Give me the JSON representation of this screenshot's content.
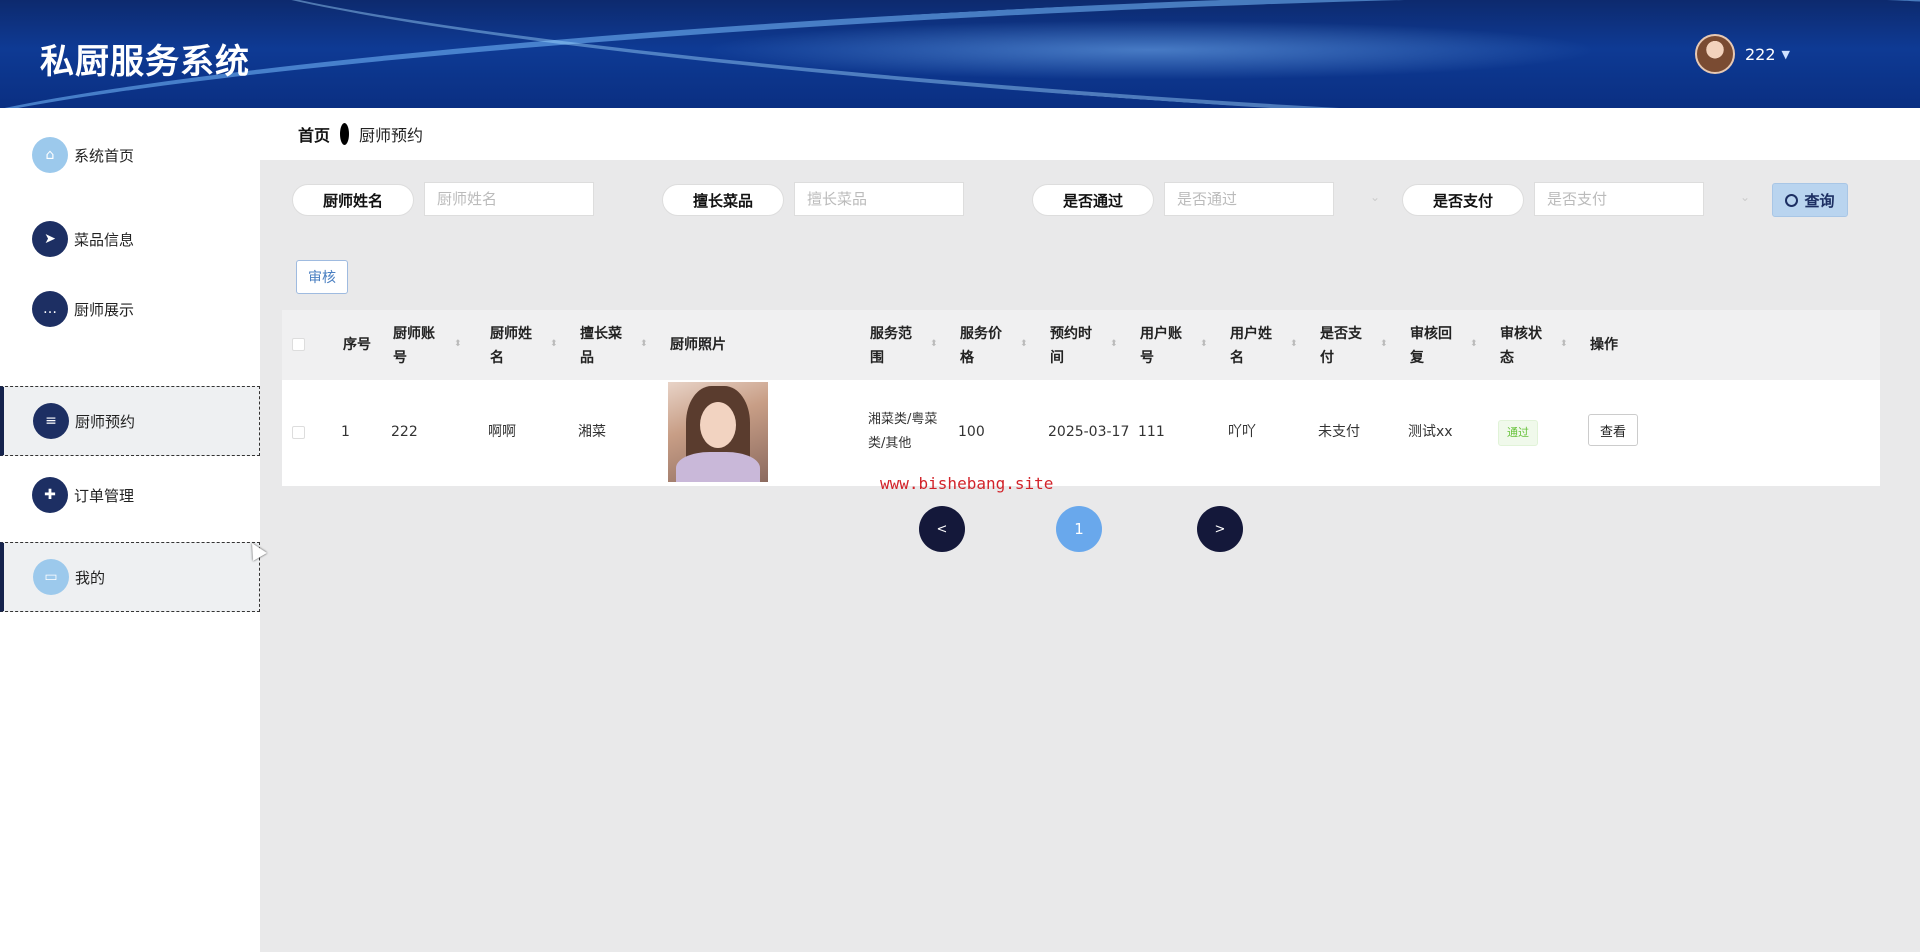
{
  "header": {
    "title": "私厨服务系统",
    "username": "222"
  },
  "sidebar": {
    "items": [
      {
        "label": "系统首页",
        "icon": "home-icon"
      },
      {
        "label": "菜品信息",
        "icon": "paper-plane-icon"
      },
      {
        "label": "厨师展示",
        "icon": "chat-icon"
      },
      {
        "label": "厨师预约",
        "icon": "list-icon"
      },
      {
        "label": "订单管理",
        "icon": "thumb-up-icon"
      },
      {
        "label": "我的",
        "icon": "card-icon"
      }
    ],
    "active": "厨师预约"
  },
  "breadcrumb": {
    "home": "首页",
    "current": "厨师预约"
  },
  "search": {
    "chef_name_label": "厨师姓名",
    "chef_name_placeholder": "厨师姓名",
    "specialty_label": "擅长菜品",
    "specialty_placeholder": "擅长菜品",
    "approved_label": "是否通过",
    "approved_placeholder": "是否通过",
    "paid_label": "是否支付",
    "paid_placeholder": "是否支付",
    "query_label": "查询"
  },
  "toolbar": {
    "audit_label": "审核"
  },
  "table": {
    "headers": {
      "index": "序号",
      "chef_account": [
        "厨师账",
        "号"
      ],
      "chef_name": [
        "厨师姓",
        "名"
      ],
      "specialty": [
        "擅长菜",
        "品"
      ],
      "chef_photo": "厨师照片",
      "service_scope": [
        "服务范",
        "围"
      ],
      "service_price": [
        "服务价",
        "格"
      ],
      "booking_time": [
        "预约时",
        "间"
      ],
      "user_account": [
        "用户账",
        "号"
      ],
      "user_name": [
        "用户姓",
        "名"
      ],
      "paid": [
        "是否支",
        "付"
      ],
      "audit_reply": [
        "审核回",
        "复"
      ],
      "audit_status": [
        "审核状",
        "态"
      ],
      "actions": "操作"
    },
    "rows": [
      {
        "index": "1",
        "chef_account": "222",
        "chef_name": "啊啊",
        "specialty": "湘菜",
        "service_scope": [
          "湘菜类/粤菜",
          "类/其他"
        ],
        "service_price": "100",
        "booking_time": "2025-03-17",
        "user_account": "111",
        "user_name": "吖吖",
        "paid": "未支付",
        "audit_reply": "测试xx",
        "audit_status": "通过",
        "action_label": "查看"
      }
    ]
  },
  "watermark": "www.bishebang.site",
  "pagination": {
    "prev": "<",
    "current": "1",
    "next": ">"
  },
  "colors": {
    "accent": "#1d2f63",
    "active_page": "#69a8ec",
    "watermark": "#d2232a",
    "status_ok": "#67c23a"
  }
}
